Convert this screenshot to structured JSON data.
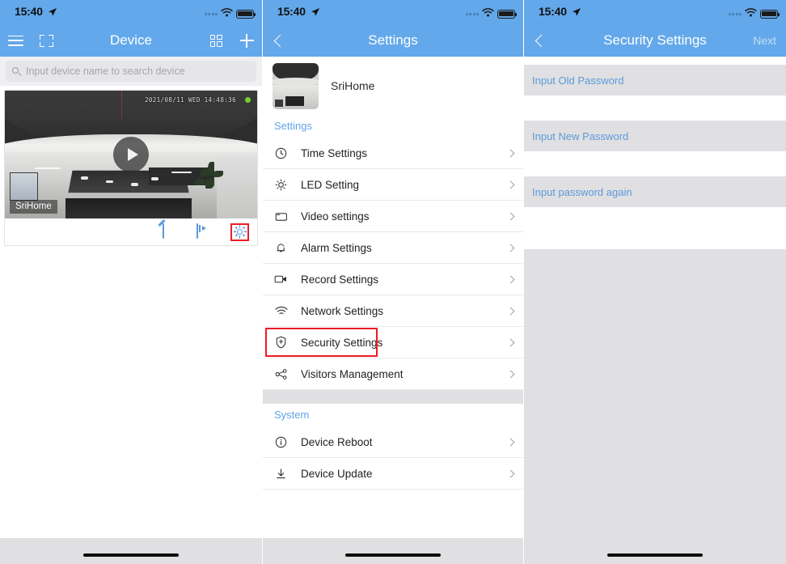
{
  "status_bar": {
    "time": "15:40",
    "location_icon": "location-arrow-icon",
    "wifi_icon": "wifi-icon",
    "battery_icon": "battery-icon"
  },
  "screen_device": {
    "nav": {
      "title": "Device",
      "menu_icon": "hamburger-menu-icon",
      "scan_icon": "scan-frame-icon",
      "grid_icon": "grid-view-icon",
      "add_icon": "plus-icon"
    },
    "search": {
      "placeholder": "Input device name to search device",
      "icon": "search-icon"
    },
    "card": {
      "timestamp": "2021/08/11  WED 14:48:36",
      "device_label": "SriHome",
      "status_dot_color": "#6fd132",
      "play_icon": "play-icon",
      "actions": [
        {
          "name": "edit-icon",
          "label": "Edit"
        },
        {
          "name": "playback-icon",
          "label": "Playback"
        },
        {
          "name": "gear-icon",
          "label": "Settings",
          "highlighted": true
        }
      ]
    }
  },
  "screen_settings": {
    "nav": {
      "title": "Settings",
      "back_icon": "chevron-left-icon"
    },
    "device": {
      "name": "SriHome",
      "thumbnail": "camera-thumbnail"
    },
    "sections": [
      {
        "label": "Settings",
        "items": [
          {
            "label": "Time Settings",
            "icon": "clock-icon"
          },
          {
            "label": "LED Setting",
            "icon": "lightbulb-icon"
          },
          {
            "label": "Video settings",
            "icon": "video-frame-icon"
          },
          {
            "label": "Alarm Settings",
            "icon": "bell-icon"
          },
          {
            "label": "Record Settings",
            "icon": "camcorder-icon"
          },
          {
            "label": "Network Settings",
            "icon": "wifi-icon"
          },
          {
            "label": "Security Settings",
            "icon": "shield-plus-icon",
            "highlighted": true
          },
          {
            "label": "Visitors Management",
            "icon": "share-nodes-icon"
          }
        ]
      },
      {
        "label": "System",
        "items": [
          {
            "label": "Device Reboot",
            "icon": "info-circle-icon"
          },
          {
            "label": "Device Update",
            "icon": "download-icon"
          }
        ]
      }
    ]
  },
  "screen_security": {
    "nav": {
      "title": "Security Settings",
      "back_icon": "chevron-left-icon",
      "next_label": "Next"
    },
    "fields": [
      {
        "placeholder": "Input Old Password",
        "value": ""
      },
      {
        "placeholder": "Input New Password",
        "value": ""
      },
      {
        "placeholder": "Input password again",
        "value": ""
      }
    ]
  },
  "colors": {
    "header_blue": "#63a8ea",
    "accent_blue": "#5a9ada",
    "highlight_red": "#ee1c25",
    "field_grey": "#e0e0e2"
  }
}
